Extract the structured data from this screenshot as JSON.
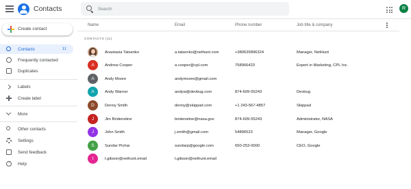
{
  "app": {
    "title": "Contacts"
  },
  "search": {
    "placeholder": "Search"
  },
  "account": {
    "initial": "R",
    "color": "#0b8043"
  },
  "sidebar": {
    "create_label": "Create contact",
    "items": [
      {
        "label": "Contacts",
        "count": "11",
        "icon": "person-icon",
        "active": true
      },
      {
        "label": "Frequently contacted",
        "icon": "history-icon"
      },
      {
        "label": "Duplicates",
        "icon": "duplicates-icon"
      }
    ],
    "labels_header": "Labels",
    "create_label_item": "Create label",
    "more_label": "More",
    "other_items": [
      {
        "label": "Other contacts",
        "icon": "people-icon"
      },
      {
        "label": "Settings",
        "icon": "gear-icon"
      },
      {
        "label": "Send feedback",
        "icon": "feedback-icon"
      },
      {
        "label": "Help",
        "icon": "help-icon"
      }
    ]
  },
  "table": {
    "columns": {
      "name": "Name",
      "email": "Email",
      "phone": "Phone number",
      "job": "Job title & company"
    },
    "section_label": "CONTACTS (11)",
    "rows": [
      {
        "initial": "",
        "photo": true,
        "color": "#c9a58a",
        "name": "Anastasia Tatsenko",
        "email": "a.tatsenko@nethunt.com",
        "phone": "+380635896324",
        "job": "Manager, NetHunt"
      },
      {
        "initial": "A",
        "color": "#d93025",
        "name": "Andrew Cooper",
        "email": "a.cooper@cpl.com",
        "phone": "758966423",
        "job": "Expert in Marketing, CPL Inc."
      },
      {
        "initial": "A",
        "color": "#5f6368",
        "name": "Andy Moore",
        "email": "andymoore@gmail.com",
        "phone": "",
        "job": ""
      },
      {
        "initial": "A",
        "color": "#12a4af",
        "name": "Andy Warner",
        "email": "andyw@devbug.com",
        "phone": "874-609-55243",
        "job": "Devbug"
      },
      {
        "initial": "D",
        "color": "#8d4a2c",
        "name": "Denny Smith",
        "email": "denny@skippad.com",
        "phone": "+1 243-567-4857",
        "job": "Skippad"
      },
      {
        "initial": "J",
        "color": "#c5221f",
        "name": "Jim Bridenstine",
        "email": "bridenstine@nasa.gov",
        "phone": "874-609-55243",
        "job": "Administrator, NASA"
      },
      {
        "initial": "J",
        "color": "#9334e6",
        "name": "John Smith",
        "email": "j.smith@gmail.com",
        "phone": "54896523",
        "job": "Manager, Google"
      },
      {
        "initial": "S",
        "color": "#43a047",
        "name": "Sundar Pichai",
        "email": "sundarp@google.com",
        "phone": "650-253-0000",
        "job": "CEO, Google"
      },
      {
        "initial": "t",
        "color": "#e52592",
        "name": "t.gibson@nethunt.email",
        "email": "t.gibson@nethunt.email",
        "phone": "",
        "job": ""
      }
    ]
  }
}
